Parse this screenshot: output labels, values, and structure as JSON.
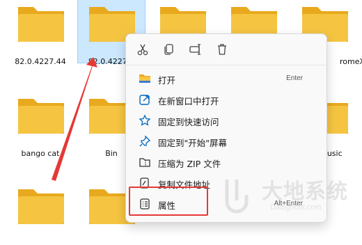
{
  "folders": [
    {
      "name": "82.0.4227.44",
      "selected": false
    },
    {
      "name": "82.0.4227.5",
      "selected": true
    },
    {
      "name": "",
      "selected": false
    },
    {
      "name": "",
      "selected": false
    },
    {
      "name": "romeX",
      "selected": false
    },
    {
      "name": "bango cat",
      "selected": false
    },
    {
      "name": "Bin",
      "selected": false
    },
    {
      "name": "",
      "selected": false
    },
    {
      "name": "",
      "selected": false
    },
    {
      "name": "Music",
      "selected": false
    },
    {
      "name": "",
      "selected": false
    },
    {
      "name": "",
      "selected": false
    }
  ],
  "context_menu": {
    "quick_actions": [
      {
        "name": "cut",
        "icon": "scissors-icon"
      },
      {
        "name": "copy",
        "icon": "copy-icon"
      },
      {
        "name": "rename",
        "icon": "rename-icon"
      },
      {
        "name": "delete",
        "icon": "trash-icon"
      }
    ],
    "items": [
      {
        "label": "打开",
        "shortcut": "Enter",
        "icon": "folder-icon"
      },
      {
        "label": "在新窗口中打开",
        "shortcut": "",
        "icon": "open-new-window-icon"
      },
      {
        "label": "固定到快速访问",
        "shortcut": "",
        "icon": "star-icon"
      },
      {
        "label": "固定到\"开始\"屏幕",
        "shortcut": "",
        "icon": "pin-icon"
      },
      {
        "label": "压缩为 ZIP 文件",
        "shortcut": "",
        "icon": "zip-icon"
      },
      {
        "label": "复制文件地址",
        "shortcut": "",
        "icon": "copy-path-icon"
      },
      {
        "label": "属性",
        "shortcut": "Alt+Enter",
        "icon": "properties-icon"
      }
    ]
  },
  "watermark": {
    "text": "大地系统",
    "url": "Dadighost.com"
  },
  "colors": {
    "folder": "#f5c542",
    "folder_back": "#e8a91e",
    "highlight": "#e53935",
    "selection": "#cce8ff",
    "accent": "#0067c0"
  }
}
